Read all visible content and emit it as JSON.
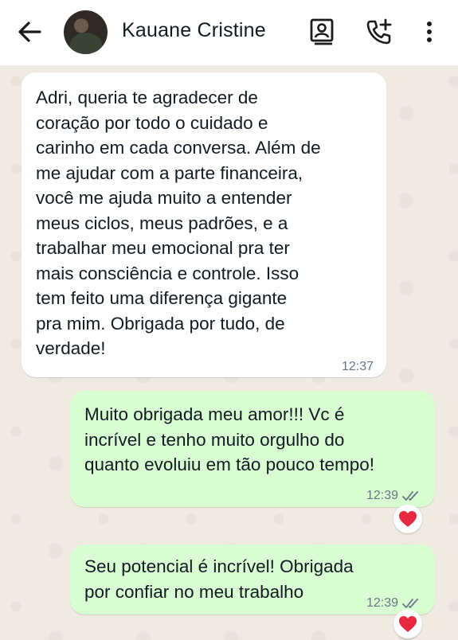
{
  "header": {
    "contact_name": "Kauane Cristine",
    "icons": [
      "back-arrow-icon",
      "avatar",
      "contact-card-icon",
      "add-call-icon",
      "more-vertical-icon"
    ]
  },
  "messages": [
    {
      "direction": "incoming",
      "text": "Adri, queria te agradecer de\ncoração por todo o cuidado e\ncarinho em cada conversa. Além de\nme ajudar com a parte financeira,\nvocê me ajuda muito a entender\nmeus ciclos, meus padrões, e a\ntrabalhar meu emocional pra ter\nmais consciência e controle. Isso\ntem feito uma diferença gigante\npra mim. Obrigada por tudo, de\nverdade!",
      "time": "12:37"
    },
    {
      "direction": "outgoing",
      "text": "Muito obrigada meu amor!!! Vc é\nincrível e tenho muito orgulho do\nquanto evoluiu em tão pouco tempo!",
      "time": "12:39",
      "reaction": "❤️"
    },
    {
      "direction": "outgoing",
      "text": "Seu potencial é incrível! Obrigada\npor confiar no meu trabalho",
      "time": "12:39",
      "reaction": "❤️"
    }
  ],
  "colors": {
    "header_bg": "#ffffff",
    "chat_bg": "#efeae2",
    "incoming_bubble": "#ffffff",
    "outgoing_bubble": "#d9fdd3",
    "meta_text": "#667781",
    "reaction_heart": "#e8283f"
  }
}
